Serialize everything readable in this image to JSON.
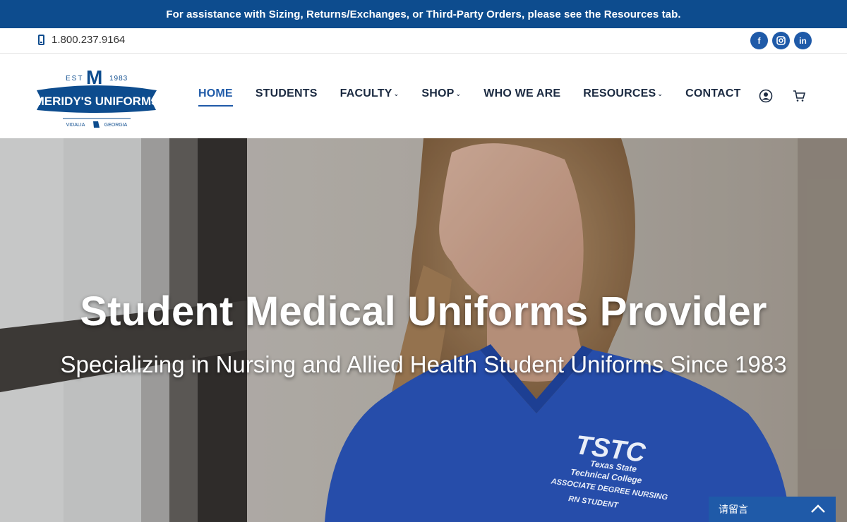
{
  "announcement": "For assistance with Sizing, Returns/Exchanges, or Third-Party Orders, please see the Resources tab.",
  "contact": {
    "phone": "1.800.237.9164",
    "phone_icon": "mobile-phone-icon"
  },
  "socials": [
    {
      "name": "facebook",
      "label": "f"
    },
    {
      "name": "instagram",
      "label": ""
    },
    {
      "name": "linkedin",
      "label": "in"
    }
  ],
  "logo": {
    "est": "EST",
    "year": "1983",
    "brand": "MERIDY'S UNIFORMS",
    "city": "VIDALIA",
    "state": "GEORGIA",
    "monogram": "M"
  },
  "nav": {
    "items": [
      {
        "label": "HOME",
        "active": true,
        "dropdown": false
      },
      {
        "label": "STUDENTS",
        "active": false,
        "dropdown": false
      },
      {
        "label": "FACULTY",
        "active": false,
        "dropdown": true
      },
      {
        "label": "SHOP",
        "active": false,
        "dropdown": true
      },
      {
        "label": "WHO WE ARE",
        "active": false,
        "dropdown": false
      },
      {
        "label": "RESOURCES",
        "active": false,
        "dropdown": true
      },
      {
        "label": "CONTACT",
        "active": false,
        "dropdown": false
      }
    ],
    "caret": "⌄",
    "account_icon": "user-circle-icon",
    "cart_icon": "shopping-cart-icon"
  },
  "hero": {
    "title": "Student Medical Uniforms Provider",
    "subtitle": "Specializing in Nursing and Allied Health Student Uniforms Since 1983",
    "patch_logo": "TSTC",
    "patch_line1": "Texas State",
    "patch_line2": "Technical College",
    "patch_line3": "ASSOCIATE DEGREE NURSING",
    "patch_line4": "RN STUDENT"
  },
  "chat": {
    "label": "请留言",
    "icon": "chevron-up-icon"
  },
  "colors": {
    "brand_blue": "#0d4c8e",
    "accent_blue": "#1f5aa8",
    "nav_text": "#1b2a41",
    "scrub_blue": "#2f5fd0"
  }
}
